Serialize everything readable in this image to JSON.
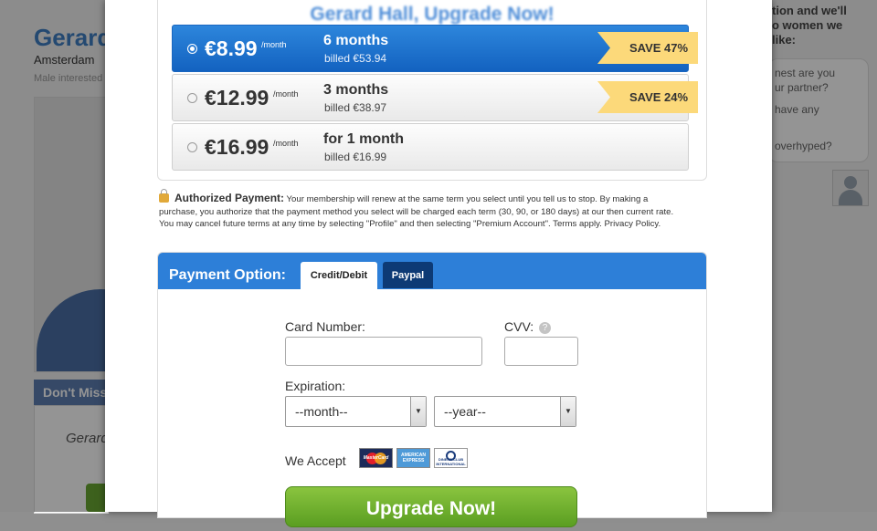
{
  "background": {
    "profile_name": "Gerard",
    "city": "Amsterdam",
    "interest": "Male interested",
    "dont_miss": "Don't Miss",
    "card_name": "Gerard",
    "right_panel": {
      "title_lines": [
        "tion and we'll",
        "o women we",
        "like:"
      ],
      "bubble_lines": [
        "nest are you",
        "ur partner?",
        "have any",
        "overhyped?"
      ]
    }
  },
  "headline": "Gerard Hall, Upgrade Now!",
  "plans": [
    {
      "price": "€8.99",
      "per": "/month",
      "term": "6 months",
      "billed": "billed €53.94",
      "save": "SAVE 47%",
      "selected": true
    },
    {
      "price": "€12.99",
      "per": "/month",
      "term": "3 months",
      "billed": "billed €38.97",
      "save": "SAVE 24%",
      "selected": false
    },
    {
      "price": "€16.99",
      "per": "/month",
      "term": "for 1 month",
      "billed": "billed €16.99",
      "save": "",
      "selected": false
    }
  ],
  "authorization": {
    "title": "Authorized Payment:",
    "text": "Your membership will renew at the same term you select until you tell us to stop. By making a purchase, you authorize that the payment method you select will be charged each term (30, 90, or 180 days) at our then current rate. You may cancel future terms at any time by selecting \"Profile\" and then selecting \"Premium Account\". Terms apply. Privacy Policy."
  },
  "payment": {
    "label": "Payment Option:",
    "tabs": [
      {
        "label": "Credit/Debit",
        "active": true
      },
      {
        "label": "Paypal",
        "active": false
      }
    ],
    "card_number_label": "Card Number:",
    "card_number_value": "",
    "cvv_label": "CVV:",
    "cvv_help": "?",
    "cvv_value": "",
    "expiration_label": "Expiration:",
    "month_selected": "--month--",
    "year_selected": "--year--",
    "accept_label": "We Accept",
    "cards": [
      {
        "name": "mastercard-icon",
        "text": "MasterCard"
      },
      {
        "name": "amex-icon",
        "text": "AMERICAN EXPRESS"
      },
      {
        "name": "diners-club-icon",
        "text": "DINERS CLUB INTERNATIONAL"
      }
    ],
    "submit_label": "Upgrade Now!"
  },
  "colors": {
    "accent": "#2d7fd8",
    "save_badge": "#fcd97a",
    "submit": "#6aa832"
  }
}
